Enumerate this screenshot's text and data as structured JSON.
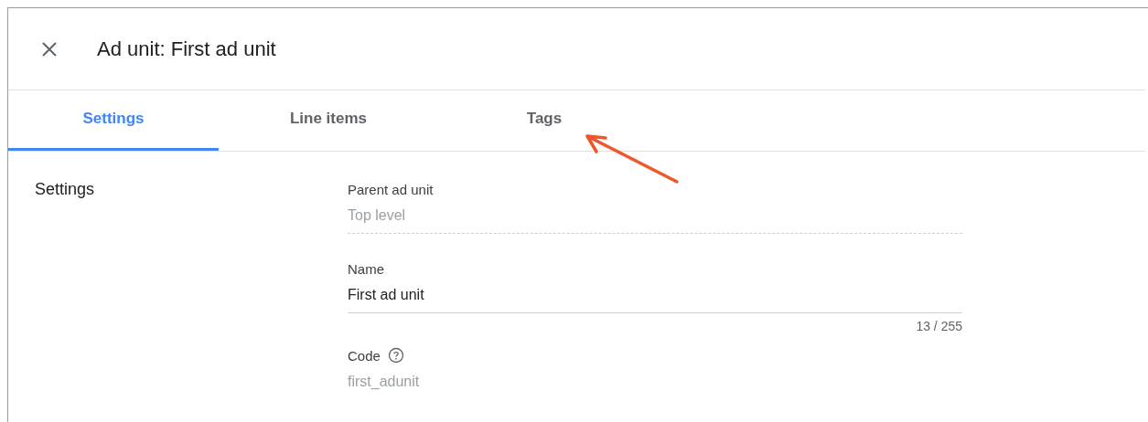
{
  "dialog": {
    "title": "Ad unit: First ad unit"
  },
  "tabs": [
    {
      "label": "Settings",
      "selected": true
    },
    {
      "label": "Line items",
      "selected": false
    },
    {
      "label": "Tags",
      "selected": false
    }
  ],
  "section": {
    "heading": "Settings"
  },
  "fields": [
    {
      "kind": "readonly",
      "label": "Parent ad unit",
      "value": "Top level",
      "help": false
    },
    {
      "kind": "input",
      "label": "Name",
      "value": "First ad unit",
      "counter": "13 / 255",
      "help": false
    },
    {
      "kind": "plain",
      "label": "Code",
      "value": "first_adunit",
      "help": true
    }
  ]
}
